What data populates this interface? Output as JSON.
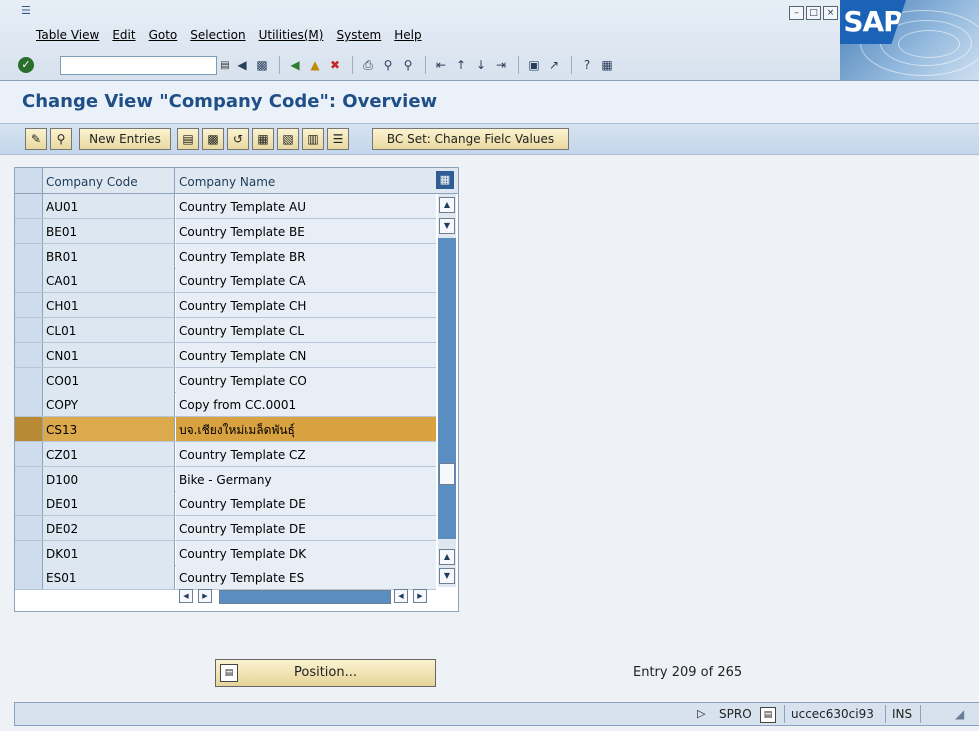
{
  "window": {
    "menu": [
      "Table View",
      "Edit",
      "Goto",
      "Selection",
      "Utilities(M)",
      "System",
      "Help"
    ],
    "logo_text": "SAP"
  },
  "toolbar": {
    "command_field_value": ""
  },
  "page": {
    "title": "Change View \"Company Code\": Overview"
  },
  "app_toolbar": {
    "new_entries_label": "New Entries",
    "bc_set_label": "BC Set: Change Fielc Values"
  },
  "table": {
    "columns": [
      "Company Code",
      "Company Name"
    ],
    "rows": [
      {
        "code": "AU01",
        "name": "Country Template AU"
      },
      {
        "code": "BE01",
        "name": "Country Template BE"
      },
      {
        "code": "BR01",
        "name": "Country Template BR"
      },
      {
        "code": "CA01",
        "name": "Country Template CA"
      },
      {
        "code": "CH01",
        "name": "Country Template CH"
      },
      {
        "code": "CL01",
        "name": "Country Template CL"
      },
      {
        "code": "CN01",
        "name": "Country Template CN"
      },
      {
        "code": "CO01",
        "name": "Country Template CO"
      },
      {
        "code": "COPY",
        "name": "Copy from CC.0001"
      },
      {
        "code": "CS13",
        "name": "บจ.เชียงใหม่เมล็ดพันธุ์"
      },
      {
        "code": "CZ01",
        "name": "Country Template CZ"
      },
      {
        "code": "D100",
        "name": "Bike - Germany"
      },
      {
        "code": "DE01",
        "name": "Country Template DE"
      },
      {
        "code": "DE02",
        "name": "Country Template DE"
      },
      {
        "code": "DK01",
        "name": "Country Template DK"
      },
      {
        "code": "ES01",
        "name": "Country Template ES"
      }
    ],
    "selected_code": "CS13"
  },
  "footer": {
    "position_button_label": "Position...",
    "entry_info": "Entry 209 of 265"
  },
  "status_bar": {
    "transaction": "SPRO",
    "server": "uccec630ci93",
    "mode": "INS"
  },
  "colors": {
    "accent": "#1f4f86",
    "selected_row": "#dcaa4c",
    "app_button": "#e9d9a0"
  }
}
